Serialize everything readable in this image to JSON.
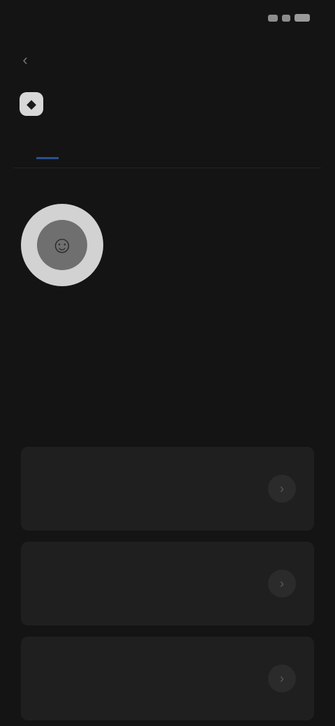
{
  "status_bar": {
    "time": "",
    "icons": [
      "signal-icon",
      "wifi-icon",
      "battery-icon"
    ]
  },
  "nav": {
    "back_icon": "back-icon",
    "back_glyph": "‹"
  },
  "brand": {
    "logo_glyph": "◆",
    "title": ""
  },
  "tabs": [
    {
      "label": "",
      "active": false
    },
    {
      "label": "",
      "active": true
    },
    {
      "label": "",
      "active": false
    }
  ],
  "profile": {
    "avatar_glyph": "☺",
    "name": "",
    "subtitle": ""
  },
  "section": {
    "title": ""
  },
  "cards": [
    {
      "title": "",
      "subtitle": "",
      "action_icon": "chevron-icon",
      "action_glyph": "›"
    },
    {
      "title": "",
      "subtitle": "",
      "action_icon": "chevron-icon",
      "action_glyph": "›"
    },
    {
      "title": "",
      "subtitle": "",
      "action_icon": "chevron-icon",
      "action_glyph": "›"
    }
  ],
  "colors": {
    "background": "#141414",
    "accent": "#4b79c7",
    "card": "#1f1f1f"
  }
}
